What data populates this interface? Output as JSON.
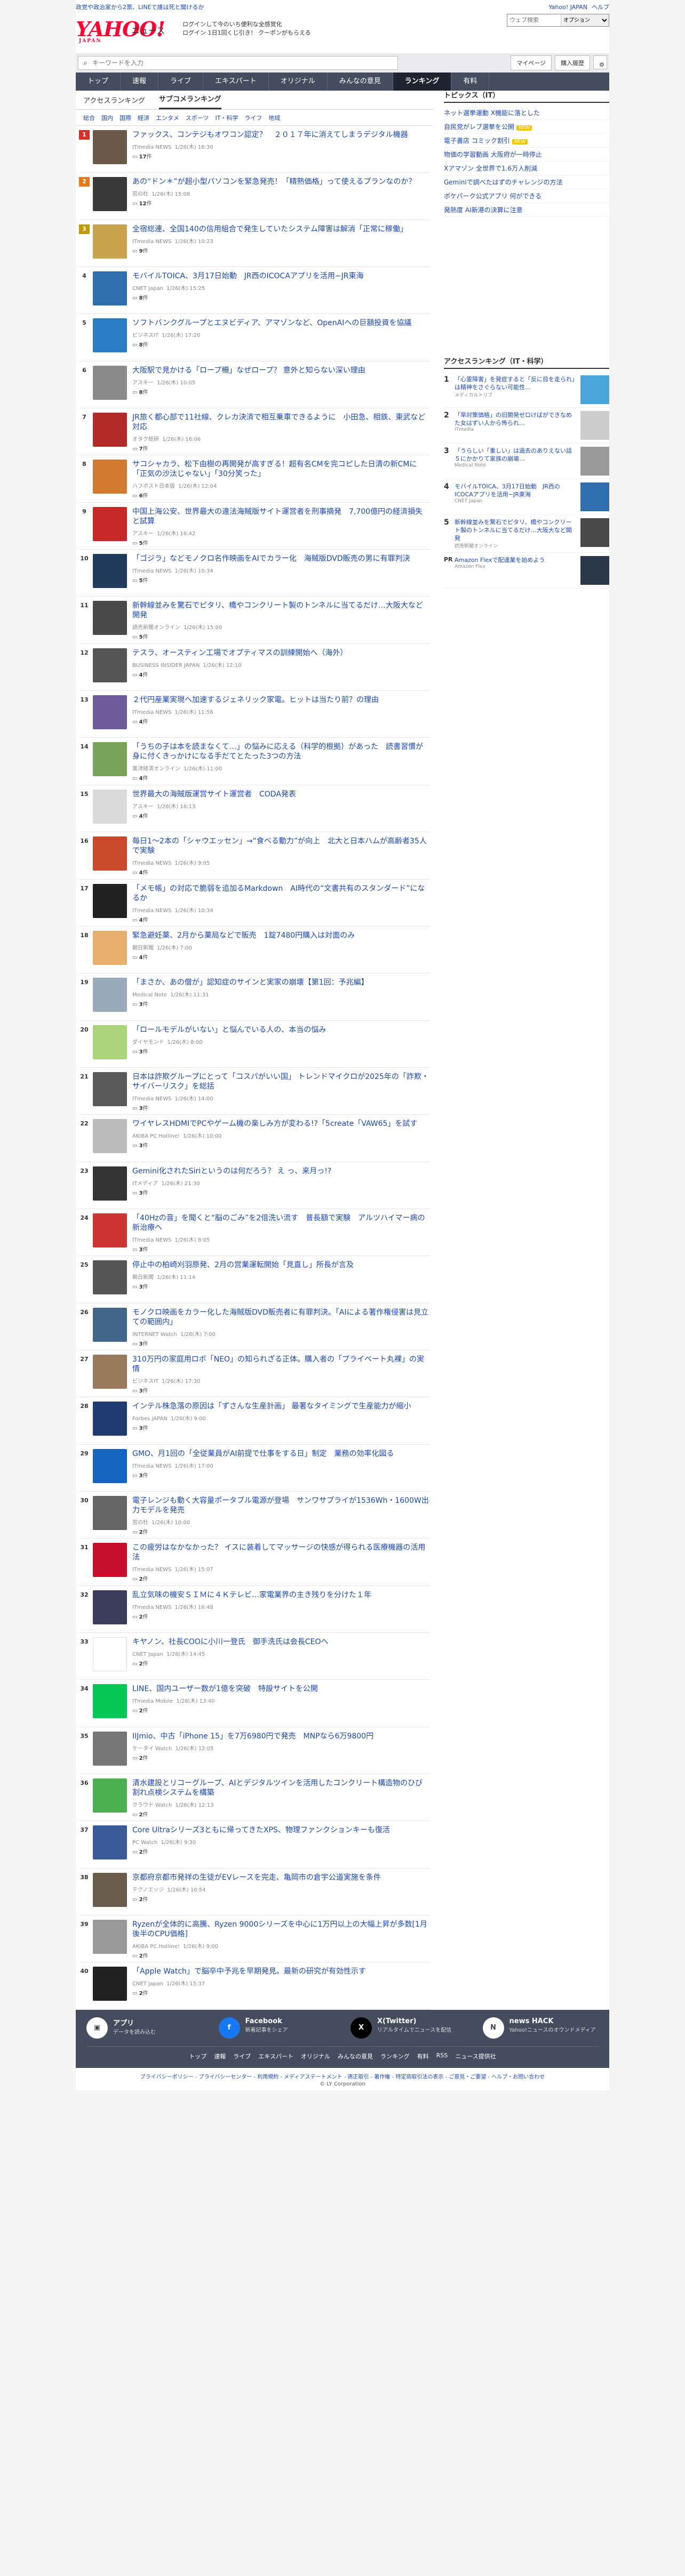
{
  "header": {
    "notice": "政党や政治家から2票、LINEで誰は死と聞けるか",
    "top_links": [
      "Yahoo! JAPAN",
      "ヘルプ"
    ],
    "search_placeholder": "ウェブ検索",
    "search_scope": "オプション",
    "logo": "YAHOO!",
    "logo_sub": "JAPAN",
    "service": "ニュース",
    "promo_line1": "ログインして今のいち便利な全感覚化",
    "promo_line2": "ログイン 1日1回くじ引き！ クーポンがもらえる",
    "search_input_placeholder": "キーワードを入力",
    "mypage": "マイページ",
    "purchase": "購入履歴",
    "gear": "設定"
  },
  "gnav": [
    "トップ",
    "速報",
    "ライブ",
    "エキスパート",
    "オリジナル",
    "みんなの意見",
    "ランキング",
    "有料"
  ],
  "subtabs": [
    "アクセスランキング",
    "サブコメランキング"
  ],
  "categories": [
    "総合",
    "国内",
    "国際",
    "経済",
    "エンタメ",
    "スポーツ",
    "IT・科学",
    "ライフ",
    "地域"
  ],
  "items": [
    {
      "rank": "1",
      "title": "ファックス、コンテジもオワコン認定？　２０１７年に消えてしまうデジタル機器",
      "source": "ITmedia NEWS",
      "time": "1/26(木) 16:30",
      "comments": "17"
    },
    {
      "rank": "2",
      "title": "あの“ドン＊”が超小型パソコンを緊急発売！「精熟価格」って使えるプランなのか？",
      "source": "窓の杜",
      "time": "1/26(木) 15:08",
      "comments": "12"
    },
    {
      "rank": "3",
      "title": "全宿総連、全国140の信用組合で発生していたシステム障害は解消「正常に稼働」",
      "source": "ITmedia NEWS",
      "time": "1/26(木) 10:23",
      "comments": "9"
    },
    {
      "rank": "4",
      "title": "モバイルTOICA、3月17日始動　JR西のICOCAアプリを活用−JR東海",
      "source": "CNET Japan",
      "time": "1/26(木) 15:25",
      "comments": "8"
    },
    {
      "rank": "5",
      "title": "ソフトバンクグループとエヌビディア、アマゾンなど、OpenAIへの巨額投資を協議",
      "source": "ビジネスIT",
      "time": "1/26(木) 17:20",
      "comments": "8"
    },
    {
      "rank": "6",
      "title": "大阪駅で見かける「ロープ柵」なぜロープ？ 意外と知らない深い理由",
      "source": "アスキー",
      "time": "1/26(木) 10:05",
      "comments": "8"
    },
    {
      "rank": "7",
      "title": "JR旅く都心部で11社線、クレカ決済で相互乗車できるように　小田急、相鉄、東武など対応",
      "source": "オタク総研",
      "time": "1/26(木) 16:06",
      "comments": "7"
    },
    {
      "rank": "8",
      "title": "サコシャカラ、松下由樹の再開発が高すぎる！超有名CMを完コピした日清の新CMに「正気の沙汰じゃない」「30分笑った」",
      "source": "ハフポスト日本版",
      "time": "1/26(木) 12:04",
      "comments": "6"
    },
    {
      "rank": "9",
      "title": "中国上海公安、世界最大の違法海賊版サイト運営者を刑事摘発　7,700億円の経済損失と試算",
      "source": "アスキー",
      "time": "1/26(木) 16:42",
      "comments": "5"
    },
    {
      "rank": "10",
      "title": "「ゴジラ」などモノクロ名作映画をAIでカラー化　海賊版DVD販売の男に有罪判決",
      "source": "ITmedia NEWS",
      "time": "1/26(木) 10:34",
      "comments": "5"
    },
    {
      "rank": "11",
      "title": "新幹線並みを驚石でピタリ、橋やコンクリート製のトンネルに当てるだけ…大阪大など開発",
      "source": "読売新聞オンライン",
      "time": "1/26(木) 15:00",
      "comments": "5"
    },
    {
      "rank": "12",
      "title": "テスラ、オースティン工場でオプティマスの訓練開始へ（海外）",
      "source": "BUSINESS INSIDER JAPAN",
      "time": "1/26(木) 12:10",
      "comments": "4"
    },
    {
      "rank": "13",
      "title": "２代円産業実現へ加速するジェネリック家電。ヒットは当たり前？の理由",
      "source": "ITmedia NEWS",
      "time": "1/26(木) 11:56",
      "comments": "4"
    },
    {
      "rank": "14",
      "title": "「うちの子は本を読まなくて…」の悩みに応える（科学的根拠）があった　読書習慣が身に付くきっかけになる手だてとたった3つの方法",
      "source": "東洋経済オンライン",
      "time": "1/26(木) 11:00",
      "comments": "4"
    },
    {
      "rank": "15",
      "title": "世界最大の海賊版運営サイト運営者　CODA発表",
      "source": "アスキー",
      "time": "1/26(木) 16:13",
      "comments": "4"
    },
    {
      "rank": "16",
      "title": "毎日1〜2本の「シャウエッセン」→“食べる動力”が向上　北大と日本ハムが高齢者35人で実験",
      "source": "ITmedia NEWS",
      "time": "1/26(木) 9:05",
      "comments": "4"
    },
    {
      "rank": "17",
      "title": "「メモ帳」の対応で脆弱を追加るMarkdown　AI時代の“文書共有のスタンダード”になるか",
      "source": "ITmedia NEWS",
      "time": "1/26(木) 10:34",
      "comments": "4"
    },
    {
      "rank": "18",
      "title": "緊急避妊薬、2月から薬局などで販売　1錠7480円購入は対面のみ",
      "source": "朝日新聞",
      "time": "1/26(木) 7:00",
      "comments": "4"
    },
    {
      "rank": "19",
      "title": "「まさか、あの僧が」認知症のサインと実家の崩壊【第1回：予兆編】",
      "source": "Medical Note",
      "time": "1/26(木) 11:31",
      "comments": "3"
    },
    {
      "rank": "20",
      "title": "「ロールモデルがいない」と悩んでいる人の、本当の悩み",
      "source": "ダイヤモンド",
      "time": "1/26(木) 8:00",
      "comments": "3"
    },
    {
      "rank": "21",
      "title": "日本は詐欺グループにとって「コスパがいい国」 トレンドマイクロが2025年の「詐欺・サイバーリスク」を総括",
      "source": "ITmedia NEWS",
      "time": "1/26(木) 14:00",
      "comments": "3"
    },
    {
      "rank": "22",
      "title": "ワイヤレスHDMIでPCやゲーム機の楽しみ方が変わる!?「5create「VAW65」を試す",
      "source": "AKIBA PC Hotline!",
      "time": "1/26(木) 10:00",
      "comments": "3"
    },
    {
      "rank": "23",
      "title": "Gemini化されたSiriというのは何だろう？ え っ、来月っ!?",
      "source": "ITメディア",
      "time": "1/26(木) 21:30",
      "comments": "3"
    },
    {
      "rank": "24",
      "title": "「40Hzの音」を聞くと“脳のごみ”を2倍洗い流す　普長額で実験　アルツハイマー病の新治療へ",
      "source": "ITmedia NEWS",
      "time": "1/26(木) 8:05",
      "comments": "3"
    },
    {
      "rank": "25",
      "title": "停止中の柏崎刈羽原発、2月の営業運転開始「見直し」所長が言及",
      "source": "朝日新聞",
      "time": "1/26(木) 11:14",
      "comments": "3"
    },
    {
      "rank": "26",
      "title": "モノクロ映画をカラー化した海賊版DVD販売者に有罪判決。「AIによる著作権侵害は見立ての範囲内」",
      "source": "INTERNET Watch",
      "time": "1/26(木) 7:00",
      "comments": "3"
    },
    {
      "rank": "27",
      "title": "310万円の家庭用ロボ「NEO」の知られざる正体。購入者の「プライベート丸裸」の実情",
      "source": "ビジネスIT",
      "time": "1/26(木) 17:30",
      "comments": "3"
    },
    {
      "rank": "28",
      "title": "インテル株急落の原因は「ずさんな生産計画」 最著なタイミングで生産能力が縮小",
      "source": "Forbes JAPAN",
      "time": "1/26(木) 9:00",
      "comments": "3"
    },
    {
      "rank": "29",
      "title": "GMO、月1回の「全従業員がAI前提で仕事をする日」制定　業務の効率化図る",
      "source": "ITmedia NEWS",
      "time": "1/26(木) 17:00",
      "comments": "3"
    },
    {
      "rank": "30",
      "title": "電子レンジも動く大容量ポータブル電源が登場　サンワサプライが1536Wh・1600W出力モデルを発売",
      "source": "窓の杜",
      "time": "1/26(木) 10:00",
      "comments": "2"
    },
    {
      "rank": "31",
      "title": "この疲労はなかなかった？ イスに装着してマッサージの快感が得られる医療機器の活用法",
      "source": "ITmedia NEWS",
      "time": "1/26(木) 15:07",
      "comments": "2"
    },
    {
      "rank": "32",
      "title": "乱立気味の機安ＳＩＭに４Ｋテレビ…家電業界の主き残りを分けた１年",
      "source": "ITmedia NEWS",
      "time": "1/26(木) 16:48",
      "comments": "2"
    },
    {
      "rank": "33",
      "title": "キヤノン、社長COOに小川一登氏　御手洗氏は会長CEOへ",
      "source": "CNET Japan",
      "time": "1/26(木) 14:45",
      "comments": "2"
    },
    {
      "rank": "34",
      "title": "LINE、国内ユーザー数が1億を突破　特設サイトを公開",
      "source": "ITmedia Mobile",
      "time": "1/26(木) 13:40",
      "comments": "2"
    },
    {
      "rank": "35",
      "title": "IIJmio、中古「iPhone 15」を7万6980円で発売　MNPなら6万9800円",
      "source": "ケータイ Watch",
      "time": "1/26(木) 12:05",
      "comments": "2"
    },
    {
      "rank": "36",
      "title": "清水建設とリコーグループ、AIとデジタルツインを活用したコンクリート構造物のひび割れ点検システムを構築",
      "source": "クラウド Watch",
      "time": "1/26(木) 12:13",
      "comments": "2"
    },
    {
      "rank": "37",
      "title": "Core Ultraシリーズ3ともに帰ってきたXPS、物理ファンクションキーも復活",
      "source": "PC Watch",
      "time": "1/26(木) 9:30",
      "comments": "2"
    },
    {
      "rank": "38",
      "title": "京都府京都市発祥の生徒がEVレースを完走、亀岡市の倉宇公道実施を条件",
      "source": "テクノエッジ",
      "time": "1/26(木) 10:54",
      "comments": "2"
    },
    {
      "rank": "39",
      "title": "Ryzenが全体的に高騰、Ryzen 9000シリーズを中心に1万円以上の大幅上昇が多数[1月後半のCPU価格]",
      "source": "AKIBA PC Hotline!",
      "time": "1/26(木) 9:00",
      "comments": "2"
    },
    {
      "rank": "40",
      "title": "「Apple Watch」で脳卒中予兆を早期発見。最新の研究が有効性示す",
      "source": "CNET Japan",
      "time": "1/26(木) 15:37",
      "comments": "2"
    }
  ],
  "item_labels": {
    "comments_suffix": "件"
  },
  "topics": {
    "title": "トピックス（IT）",
    "items": [
      "ネット選挙運動 X機能に落とした",
      "自民党がレブ選挙を公開",
      "電子書店 コミック割引",
      "物価の学習動画 大阪府が一時停止",
      "Xアマゾン 全世界で1.6万人削減",
      "Geminiで調べたはずのチャレンジの方法",
      "ポケパーク公式アプリ 何ができる",
      "発熱度 AI新港の決算に注意"
    ],
    "tag": "NEW"
  },
  "access": {
    "title": "アクセスランキング（IT・科学）",
    "items": [
      {
        "n": "1",
        "t": "「心霊障害」を発症すると「反に目を走られ」は精神をさぐらない可能性…",
        "m": "メディカルトリブ"
      },
      {
        "n": "2",
        "t": "「旱対策価格」の旧開発ゼロけばができなめた女はずい人から怖られ…",
        "m": "ITmedia"
      },
      {
        "n": "3",
        "t": "「うらしい「重しい」は過去のありえない話 ５にかかりて家族の崩壊…",
        "m": "Medical Note"
      },
      {
        "n": "4",
        "t": "モバイルTOICA、3月17日始動　JR西のICOCAアプリを活用−JR東海",
        "m": "CNET Japan"
      },
      {
        "n": "5",
        "t": "新幹線並みを驚石でピタリ、橋やコンクリート製のトンネルに当てるだけ…大阪大など開発",
        "m": "読売新聞オンライン"
      }
    ]
  },
  "pr": {
    "label": "PR",
    "title": "Amazon Flexで配達業を始めよう",
    "source": "Amazon Flex"
  },
  "footer": {
    "apps": [
      {
        "name": "アプリ",
        "desc": "データを読み込む"
      },
      {
        "name": "Facebook",
        "desc": "新着記事をシェア"
      },
      {
        "name": "X(Twitter)",
        "desc": "リアルタイムでニュースを配信"
      },
      {
        "name": "news HACK",
        "desc": "Yahoo!ニュースのオウンドメディア"
      }
    ],
    "links": [
      "トップ",
      "速報",
      "ライブ",
      "エキスパート",
      "オリジナル",
      "みんなの意見",
      "ランキング",
      "有料",
      "RSS",
      "ニュース提供社"
    ],
    "legal": "プライバシーポリシー - プライバシーセンター - 利用規約 - メディアステートメント - 適正取引 - 著作権 - 特定商取引法の表示 - ご意見・ご要望 - ヘルプ・お問い合わせ",
    "copy": "© LY Corporation"
  },
  "colors": {
    "nav": "#444c5e",
    "link": "#1a47b8",
    "rank1": "#d6312a"
  }
}
